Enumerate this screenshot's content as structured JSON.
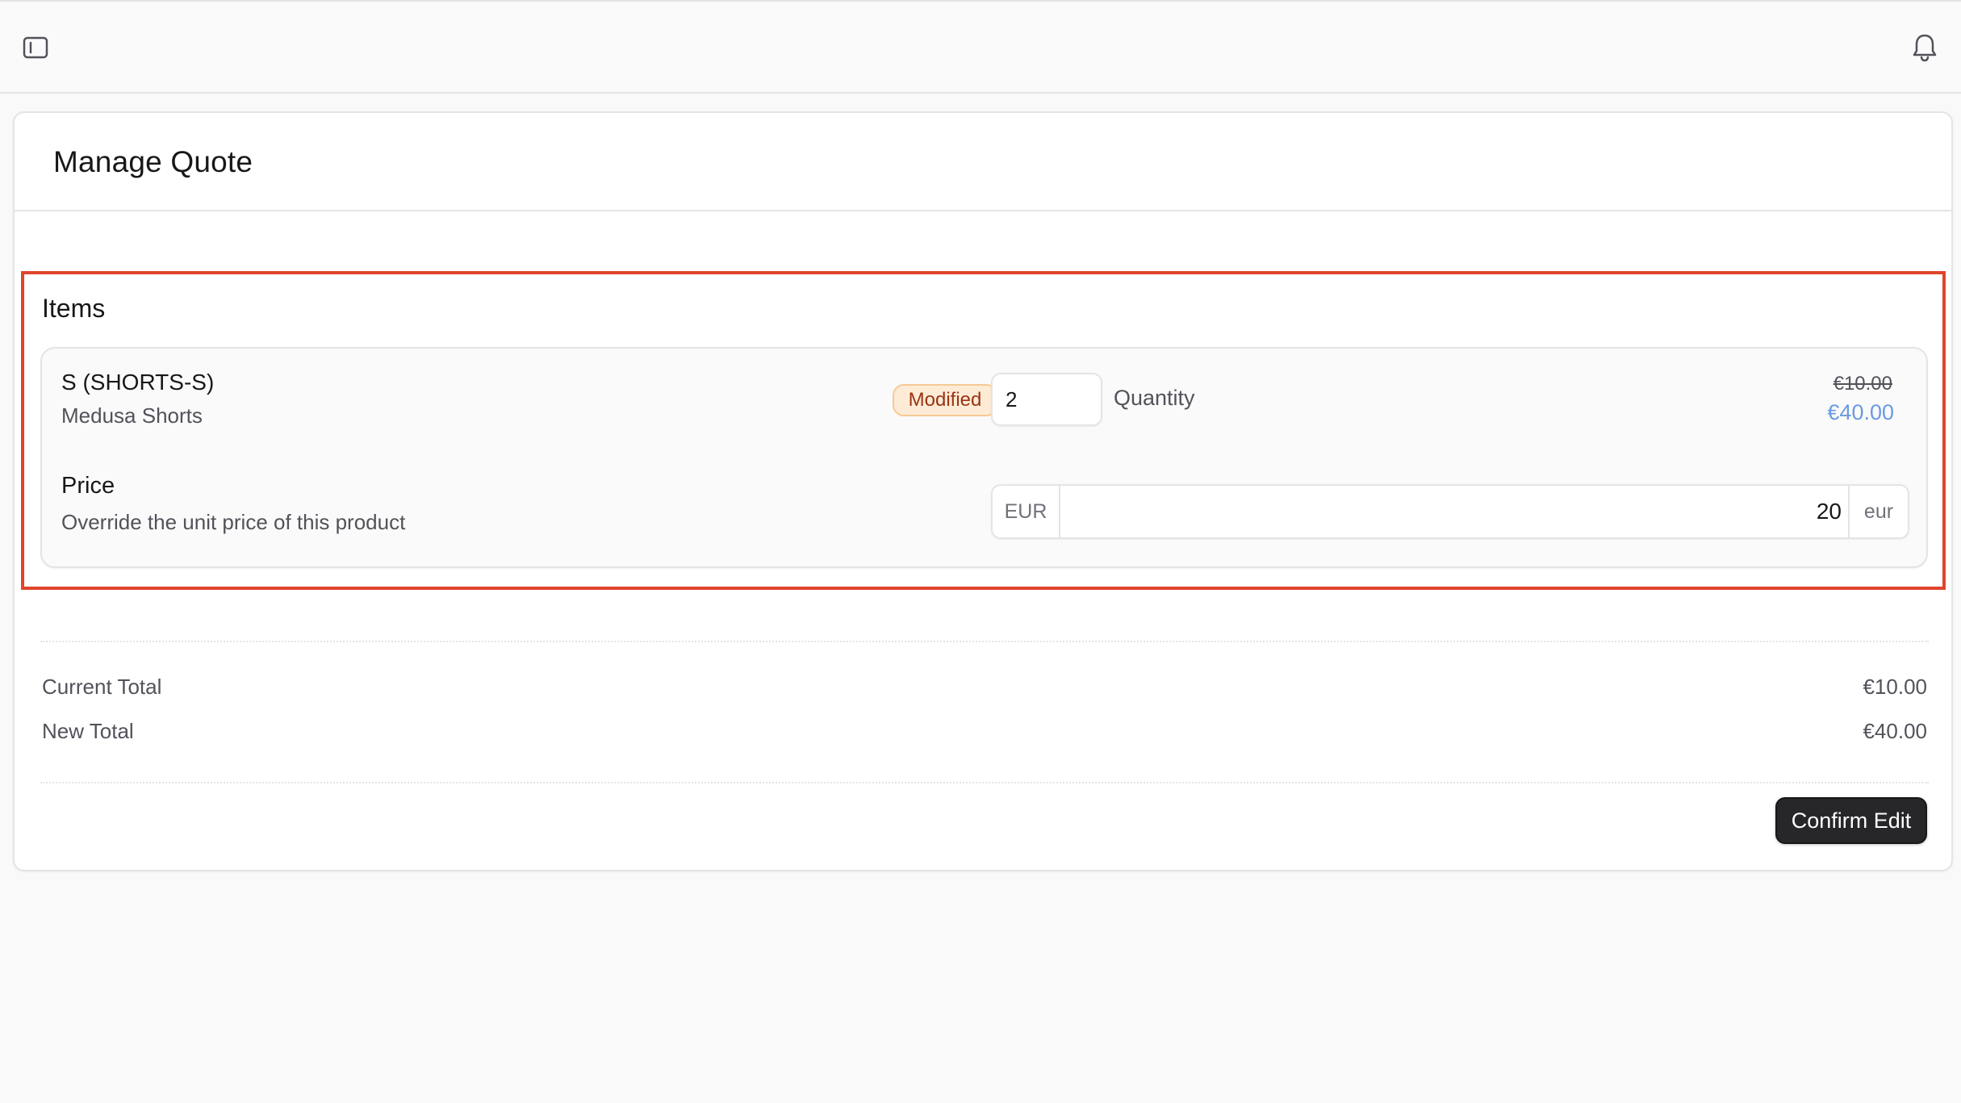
{
  "topbar": {
    "sidebar_toggle_icon": "sidebar-toggle-icon",
    "notifications_icon": "bell-icon"
  },
  "page": {
    "title": "Manage Quote"
  },
  "items_section": {
    "heading": "Items",
    "item": {
      "variant_title": "S (SHORTS-S)",
      "product_title": "Medusa Shorts",
      "badge": "Modified",
      "quantity_value": "2",
      "quantity_label": "Quantity",
      "original_total": "€10.00",
      "new_total": "€40.00",
      "price_heading": "Price",
      "price_description": "Override the unit price of this product",
      "price_currency_prefix": "EUR",
      "price_value": "20",
      "price_currency_suffix": "eur"
    }
  },
  "totals": {
    "current_label": "Current Total",
    "current_value": "€10.00",
    "new_label": "New Total",
    "new_value": "€40.00"
  },
  "actions": {
    "confirm_label": "Confirm Edit"
  },
  "colors": {
    "highlight_border": "#e0452b",
    "badge_background": "#fdebd6",
    "badge_text": "#9a3412",
    "new_price_text": "#6b9be0",
    "primary_button": "#27272a"
  }
}
